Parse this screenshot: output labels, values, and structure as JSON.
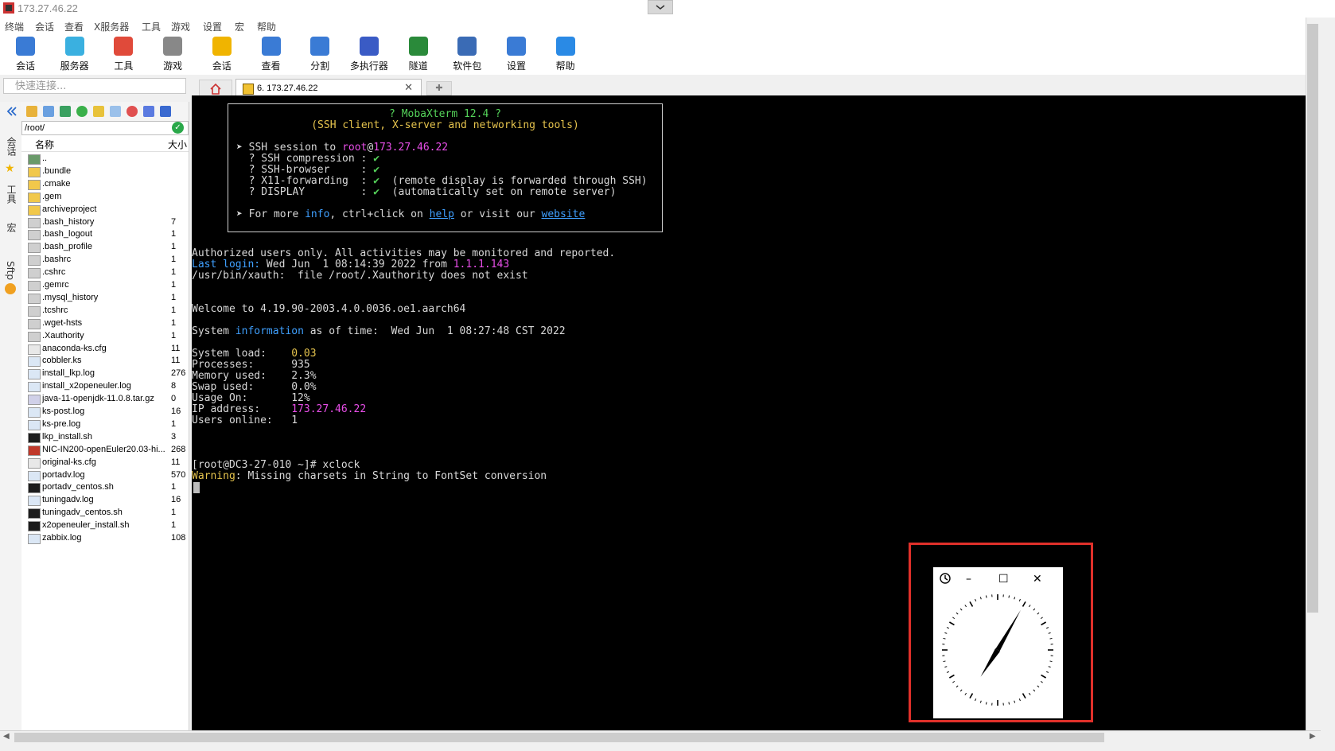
{
  "window": {
    "title": "173.27.46.22"
  },
  "menu": [
    "终端",
    "会话",
    "查看",
    "X服务器",
    "工具",
    "游戏",
    "设置",
    "宏",
    "帮助"
  ],
  "toolbar": [
    {
      "label": "会话",
      "icon": "session-monitor-icon",
      "color": "#3a7bd5"
    },
    {
      "label": "服务器",
      "icon": "servers-icon",
      "color": "#3ab0e0"
    },
    {
      "label": "工具",
      "icon": "tools-icon",
      "color": "#e04a3a"
    },
    {
      "label": "游戏",
      "icon": "games-icon",
      "color": "#888888"
    },
    {
      "label": "会话",
      "icon": "star-icon",
      "color": "#f0b400"
    },
    {
      "label": "查看",
      "icon": "view-icon",
      "color": "#3a7bd5"
    },
    {
      "label": "分割",
      "icon": "split-icon",
      "color": "#3a7bd5"
    },
    {
      "label": "多执行器",
      "icon": "multiexec-icon",
      "color": "#3a5bc5"
    },
    {
      "label": "隧道",
      "icon": "tunnel-icon",
      "color": "#2a8a3a"
    },
    {
      "label": "软件包",
      "icon": "packages-icon",
      "color": "#3a6bb5"
    },
    {
      "label": "设置",
      "icon": "settings-gear-icon",
      "color": "#3a7bd5"
    },
    {
      "label": "帮助",
      "icon": "help-icon",
      "color": "#2a8ae5"
    }
  ],
  "quick_connect": {
    "placeholder": "快速连接..."
  },
  "tabs": [
    {
      "label": "6. 173.27.46.22"
    }
  ],
  "side_strip": [
    "会话",
    "工具",
    "宏",
    "Sftp"
  ],
  "sftp": {
    "path": "/root/",
    "col_name": "名称",
    "col_size": "大小",
    "files": [
      {
        "name": "..",
        "size": "",
        "type": "up"
      },
      {
        "name": ".bundle",
        "size": "",
        "type": "folder"
      },
      {
        "name": ".cmake",
        "size": "",
        "type": "folder"
      },
      {
        "name": ".gem",
        "size": "",
        "type": "folder"
      },
      {
        "name": "archiveproject",
        "size": "",
        "type": "folder"
      },
      {
        "name": ".bash_history",
        "size": "7",
        "type": "hidden"
      },
      {
        "name": ".bash_logout",
        "size": "1",
        "type": "hidden"
      },
      {
        "name": ".bash_profile",
        "size": "1",
        "type": "hidden"
      },
      {
        "name": ".bashrc",
        "size": "1",
        "type": "hidden"
      },
      {
        "name": ".cshrc",
        "size": "1",
        "type": "hidden"
      },
      {
        "name": ".gemrc",
        "size": "1",
        "type": "hidden"
      },
      {
        "name": ".mysql_history",
        "size": "1",
        "type": "hidden"
      },
      {
        "name": ".tcshrc",
        "size": "1",
        "type": "hidden"
      },
      {
        "name": ".wget-hsts",
        "size": "1",
        "type": "hidden"
      },
      {
        "name": ".Xauthority",
        "size": "1",
        "type": "hidden"
      },
      {
        "name": "anaconda-ks.cfg",
        "size": "11",
        "type": "cfg"
      },
      {
        "name": "cobbler.ks",
        "size": "11",
        "type": "doc"
      },
      {
        "name": "install_lkp.log",
        "size": "276",
        "type": "doc"
      },
      {
        "name": "install_x2openeuler.log",
        "size": "8",
        "type": "doc"
      },
      {
        "name": "java-11-openjdk-11.0.8.tar.gz",
        "size": "0",
        "type": "archive"
      },
      {
        "name": "ks-post.log",
        "size": "16",
        "type": "doc"
      },
      {
        "name": "ks-pre.log",
        "size": "1",
        "type": "doc"
      },
      {
        "name": "lkp_install.sh",
        "size": "3",
        "type": "script"
      },
      {
        "name": "NIC-IN200-openEuler20.03-hi...",
        "size": "268",
        "type": "rpm"
      },
      {
        "name": "original-ks.cfg",
        "size": "11",
        "type": "cfg"
      },
      {
        "name": "portadv.log",
        "size": "570",
        "type": "doc"
      },
      {
        "name": "portadv_centos.sh",
        "size": "1",
        "type": "script"
      },
      {
        "name": "tuningadv.log",
        "size": "16",
        "type": "doc"
      },
      {
        "name": "tuningadv_centos.sh",
        "size": "1",
        "type": "script"
      },
      {
        "name": "x2openeuler_install.sh",
        "size": "1",
        "type": "script"
      },
      {
        "name": "zabbix.log",
        "size": "108",
        "type": "doc"
      }
    ]
  },
  "terminal": {
    "banner_title": "? MobaXterm 12.4 ?",
    "banner_subtitle": "(SSH client, X-server and networking tools)",
    "ssh_prefix": "➤ SSH session to ",
    "ssh_user": "root",
    "ssh_at": "@",
    "ssh_host": "173.27.46.22",
    "features": [
      {
        "name": "  ? SSH compression : ",
        "mark": "✔",
        "note": ""
      },
      {
        "name": "  ? SSH-browser     : ",
        "mark": "✔",
        "note": ""
      },
      {
        "name": "  ? X11-forwarding  : ",
        "mark": "✔",
        "note": "  (remote display is forwarded through SSH)"
      },
      {
        "name": "  ? DISPLAY         : ",
        "mark": "✔",
        "note": "  (automatically set on remote server)"
      }
    ],
    "more_prefix": "➤ For more ",
    "more_info": "info",
    "more_mid": ", ctrl+click on ",
    "more_help": "help",
    "more_mid2": " or visit our ",
    "more_site": "website",
    "authorized": "Authorized users only. All activities may be monitored and reported.",
    "last_login_label": "Last login:",
    "last_login_text": " Wed Jun  1 08:14:39 2022 from ",
    "last_login_ip": "1.1.1.143",
    "xauth": "/usr/bin/xauth:  file /root/.Xauthority does not exist",
    "welcome": "Welcome to 4.19.90-2003.4.0.0036.oe1.aarch64",
    "sysinfo_pre": "System ",
    "sysinfo_word": "information",
    "sysinfo_post": " as of time:  Wed Jun  1 08:27:48 CST 2022",
    "stats": [
      {
        "k": "System load:    ",
        "v": "0.03",
        "c": "yellow"
      },
      {
        "k": "Processes:      ",
        "v": "935",
        "c": ""
      },
      {
        "k": "Memory used:    ",
        "v": "2.3%",
        "c": ""
      },
      {
        "k": "Swap used:      ",
        "v": "0.0%",
        "c": ""
      },
      {
        "k": "Usage On:       ",
        "v": "12%",
        "c": ""
      },
      {
        "k": "IP address:     ",
        "v": "173.27.46.22",
        "c": "mag"
      },
      {
        "k": "Users online:   ",
        "v": "1",
        "c": ""
      }
    ],
    "prompt": "[root@DC3-27-010 ~]# xclock",
    "warning_label": "Warning",
    "warning_text": ": Missing charsets in String to FontSet conversion"
  },
  "xclock": {
    "min_button": "–",
    "max_button": "☐",
    "close_button": "✕",
    "time_shown": "7:05"
  },
  "colors": {
    "terminal_bg": "#000000",
    "highlight_box": "#e0302a"
  }
}
